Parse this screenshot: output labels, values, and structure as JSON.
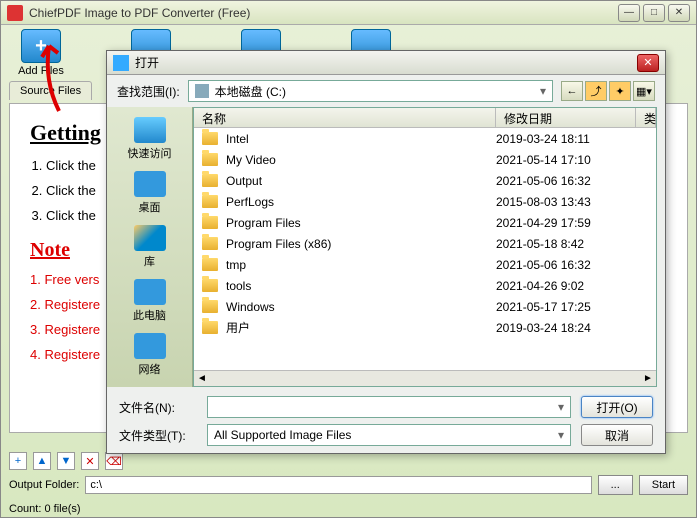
{
  "main": {
    "title": "ChiefPDF Image to PDF Converter (Free)",
    "toolbar": {
      "addFiles": "Add Files"
    },
    "tab": "Source Files",
    "heading": "Getting",
    "steps": [
      "Click the",
      "Click the",
      "Click the"
    ],
    "noteTitle": "Note",
    "notes": [
      "Free vers",
      "Registere",
      "Registere",
      "Registere"
    ],
    "outputLabel": "Output Folder:",
    "outputValue": "c:\\",
    "browseBtn": "...",
    "startBtn": "Start",
    "status": "Count:  0 file(s)"
  },
  "dialog": {
    "title": "打开",
    "lookIn": "查找范围(I):",
    "drive": "本地磁盘 (C:)",
    "places": {
      "quick": "快速访问",
      "desktop": "桌面",
      "lib": "库",
      "pc": "此电脑",
      "net": "网络"
    },
    "cols": {
      "name": "名称",
      "date": "修改日期",
      "type": "类"
    },
    "rows": [
      {
        "name": "Intel",
        "date": "2019-03-24 18:11"
      },
      {
        "name": "My Video",
        "date": "2021-05-14 17:10"
      },
      {
        "name": "Output",
        "date": "2021-05-06 16:32"
      },
      {
        "name": "PerfLogs",
        "date": "2015-08-03 13:43"
      },
      {
        "name": "Program Files",
        "date": "2021-04-29 17:59"
      },
      {
        "name": "Program Files (x86)",
        "date": "2021-05-18 8:42"
      },
      {
        "name": "tmp",
        "date": "2021-05-06 16:32"
      },
      {
        "name": "tools",
        "date": "2021-04-26 9:02"
      },
      {
        "name": "Windows",
        "date": "2021-05-17 17:25"
      },
      {
        "name": "用户",
        "date": "2019-03-24 18:24"
      }
    ],
    "fileNameLabel": "文件名(N):",
    "fileTypeLabel": "文件类型(T):",
    "fileTypeValue": "All Supported Image Files",
    "openBtn": "打开(O)",
    "cancelBtn": "取消"
  }
}
